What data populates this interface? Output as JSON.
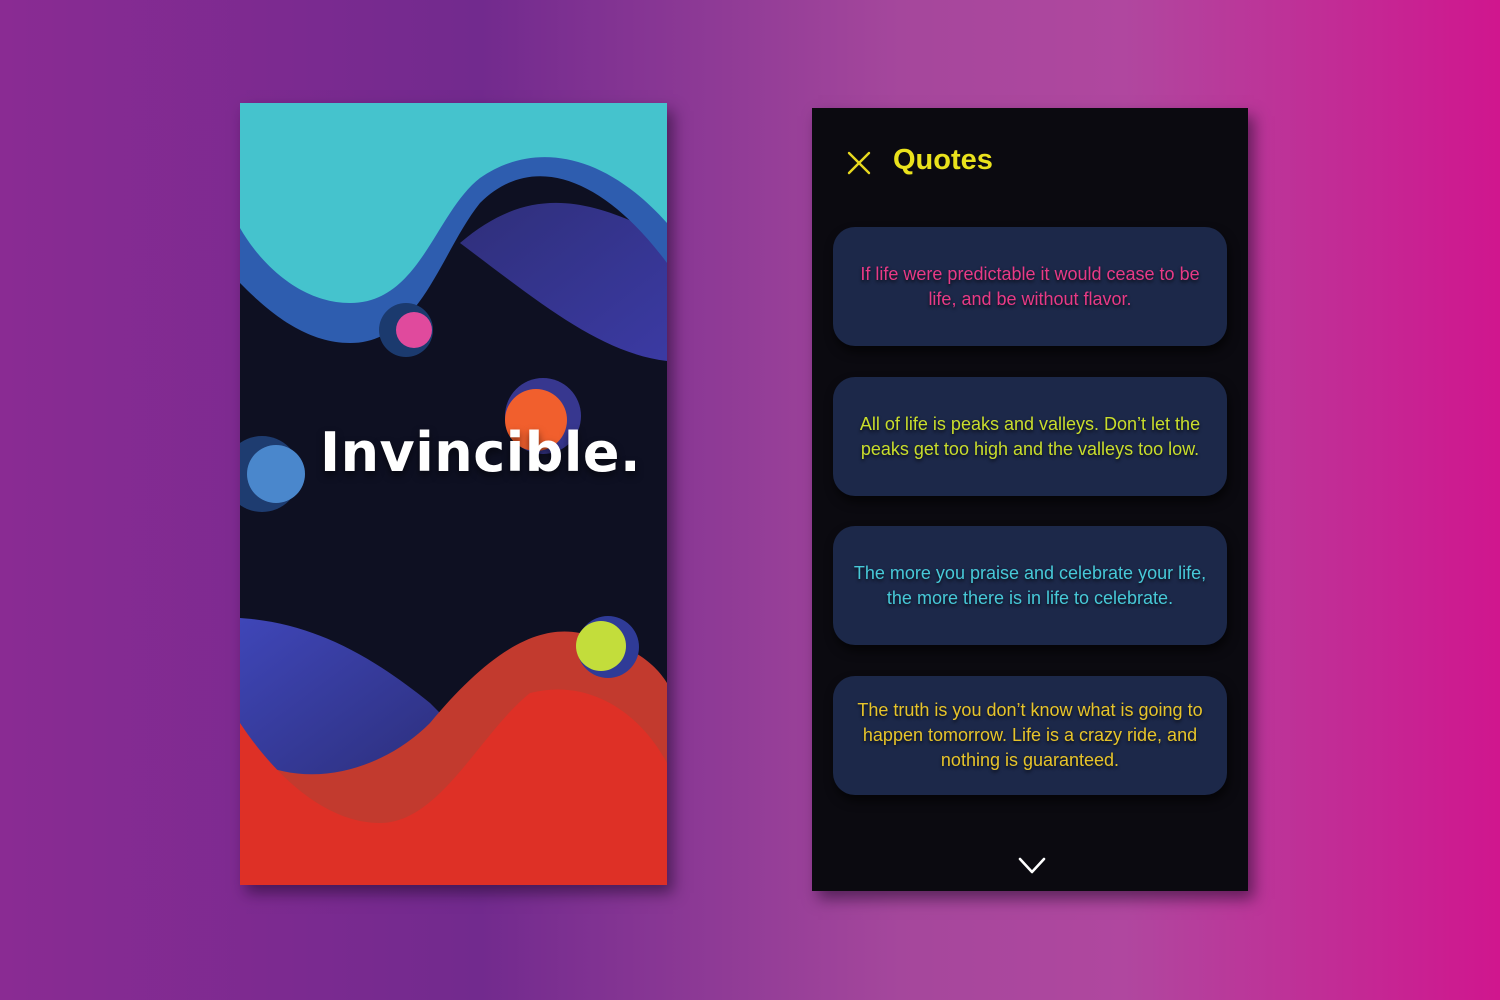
{
  "left_screen": {
    "title": "Invincible."
  },
  "right_screen": {
    "header": {
      "title": "Quotes",
      "close_icon": "close-icon",
      "close_color": "#e7d81f",
      "title_color": "#eae21c"
    },
    "quotes": [
      {
        "text": "If life were predictable it would cease to be life, and be without flavor.",
        "color": "#e83a86"
      },
      {
        "text": "All of life is peaks and valleys. Don’t let the peaks get too high and the valleys too low.",
        "color": "#c9dd2c"
      },
      {
        "text": "The more you praise and celebrate your life, the more there is in life to celebrate.",
        "color": "#47c9d8"
      },
      {
        "text": "The truth is you don’t know what is going to happen tomorrow. Life is a crazy ride, and nothing is guaranteed.",
        "color": "#e7c42a"
      }
    ],
    "footer": {
      "icon": "chevron-down-icon"
    }
  }
}
